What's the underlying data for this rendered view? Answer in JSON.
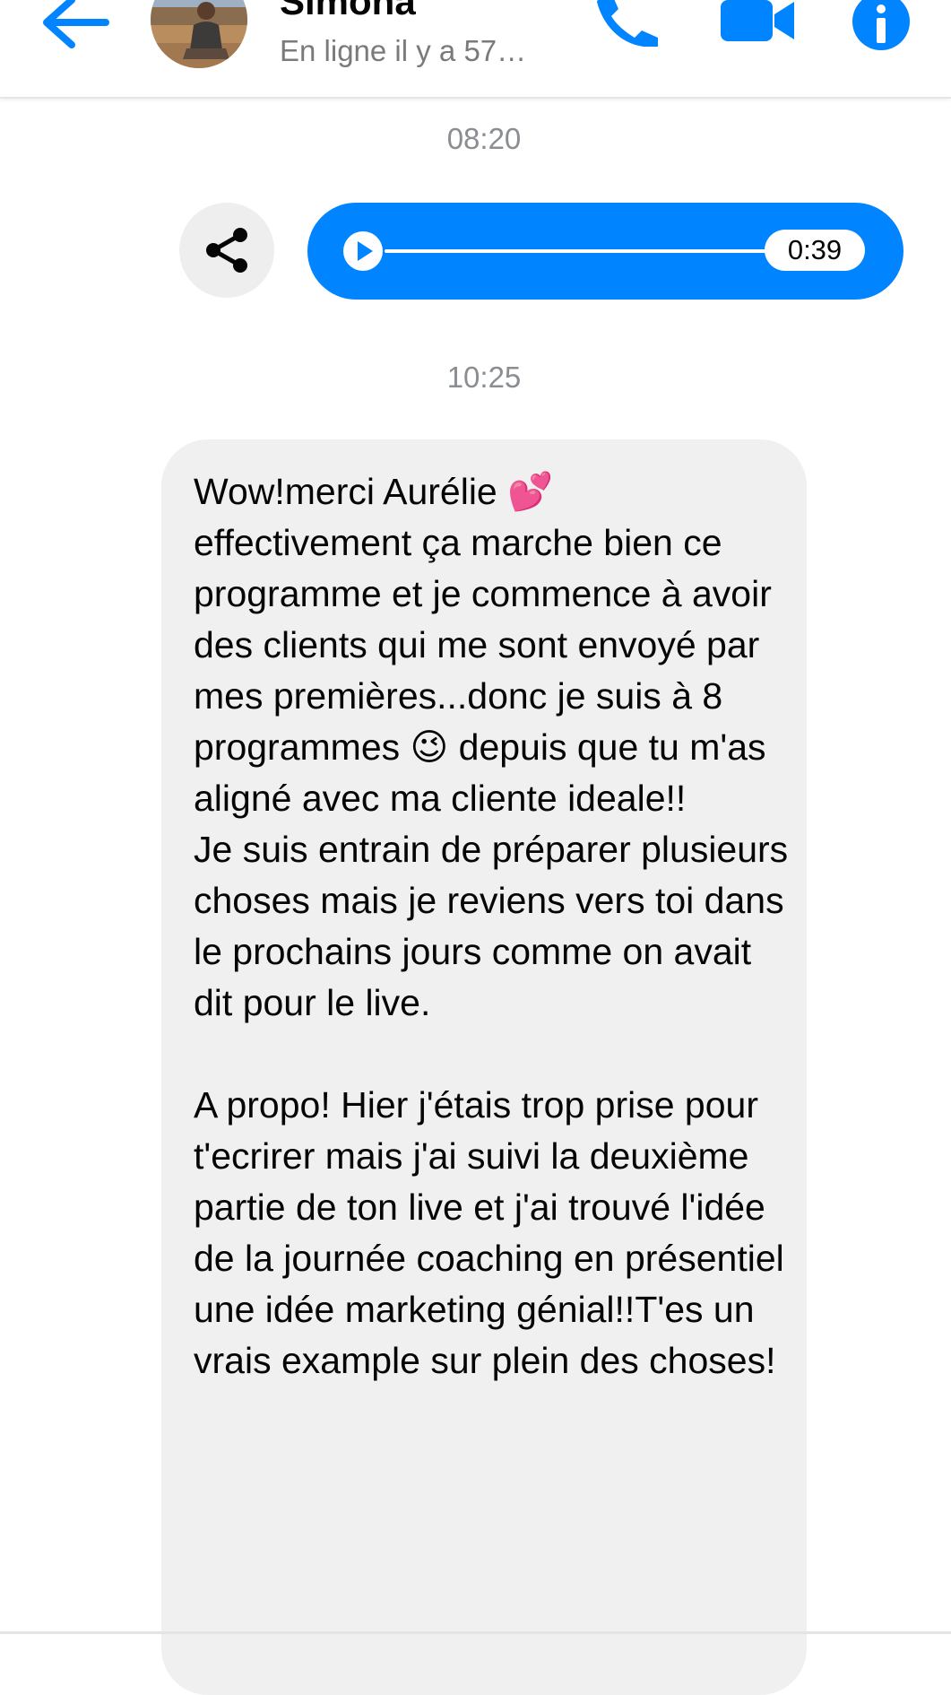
{
  "header": {
    "back_icon": "arrow-left-icon",
    "contact_name": "Simona",
    "status": "En ligne il y a 57…",
    "actions": {
      "call_icon": "phone-icon",
      "video_icon": "video-camera-icon",
      "info_icon": "info-icon"
    }
  },
  "colors": {
    "accent": "#0084ff",
    "received_bubble": "#f0f0f0",
    "timestamp": "#8a8d91"
  },
  "conversation": {
    "timestamp_1": "08:20",
    "audio_message": {
      "duration": "0:39",
      "progress": 0,
      "share_icon": "share-icon",
      "play_icon": "play-icon"
    },
    "timestamp_2": "10:25",
    "text_message": {
      "text": "Wow!merci Aurélie 💕\neffectivement ça marche bien ce programme et je commence à avoir des clients qui me sont envoyé par mes premières...donc je suis à 8 programmes 😉 depuis que tu m'as aligné avec ma cliente ideale!!\nJe suis entrain de préparer plusieurs choses mais je reviens vers toi dans le prochains jours comme on avait dit pour le live.\n\nA propo! Hier j'étais trop prise pour t'ecrirer mais j'ai suivi la deuxième partie de ton live et j'ai trouvé l'idée de la journée coaching en présentiel une idée marketing génial!!T'es un vrais example sur plein des choses!"
    }
  }
}
